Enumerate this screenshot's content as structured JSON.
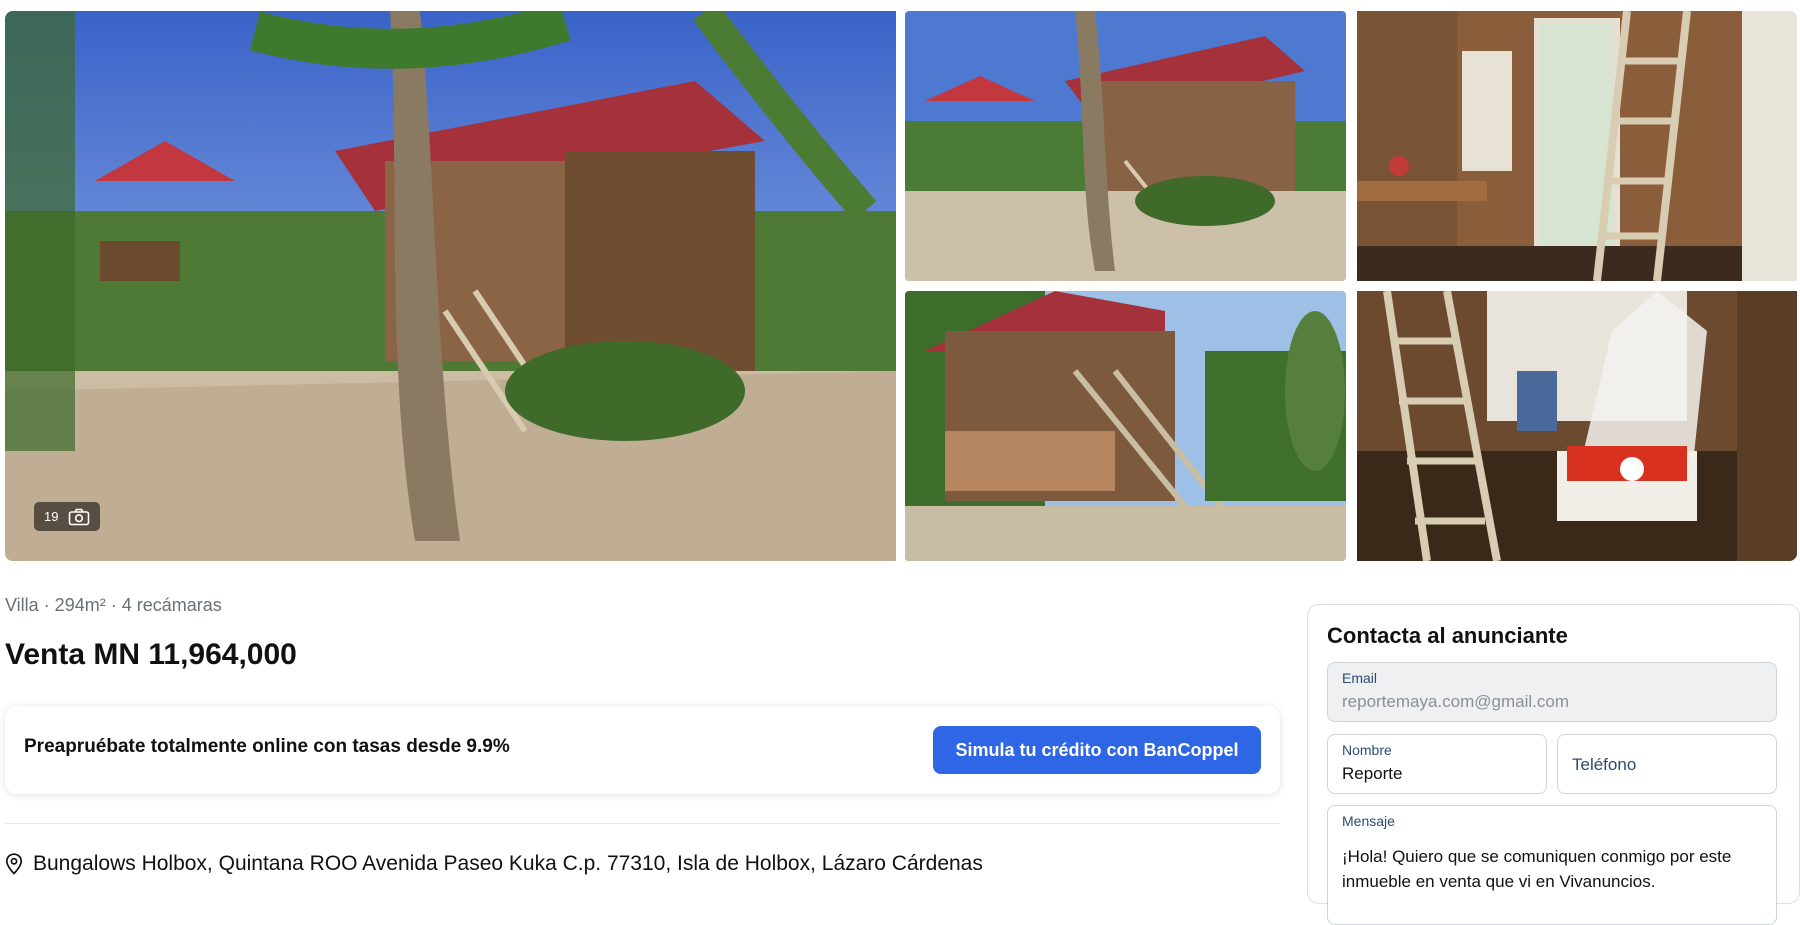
{
  "gallery": {
    "photo_count": "19",
    "photos": [
      {
        "name": "bungalow-exterior-main"
      },
      {
        "name": "bungalow-exterior-side"
      },
      {
        "name": "interior-ladder-door"
      },
      {
        "name": "bungalow-stairs"
      },
      {
        "name": "interior-bed-mosquito-net"
      }
    ]
  },
  "listing": {
    "meta": "Villa · 294m² · 4 recámaras",
    "price": "Venta MN 11,964,000",
    "promo_text": "Preapruébate totalmente online con tasas desde 9.9%",
    "promo_button": "Simula tu crédito con BanCoppel",
    "address": "Bungalows Holbox, Quintana ROO Avenida Paseo Kuka C.p. 77310, Isla de Holbox, Lázaro Cárdenas"
  },
  "contact": {
    "title": "Contacta al anunciante",
    "email_label": "Email",
    "email_value": "reportemaya.com@gmail.com",
    "name_label": "Nombre",
    "name_value": "Reporte",
    "phone_placeholder": "Teléfono",
    "message_label": "Mensaje",
    "message_value": "¡Hola! Quiero que se comuniquen conmigo por este inmueble en venta que vi en Vivanuncios."
  },
  "colors": {
    "accent": "#2e66e6",
    "muted_text": "#6b6f76",
    "label_text": "#2d4a73"
  }
}
